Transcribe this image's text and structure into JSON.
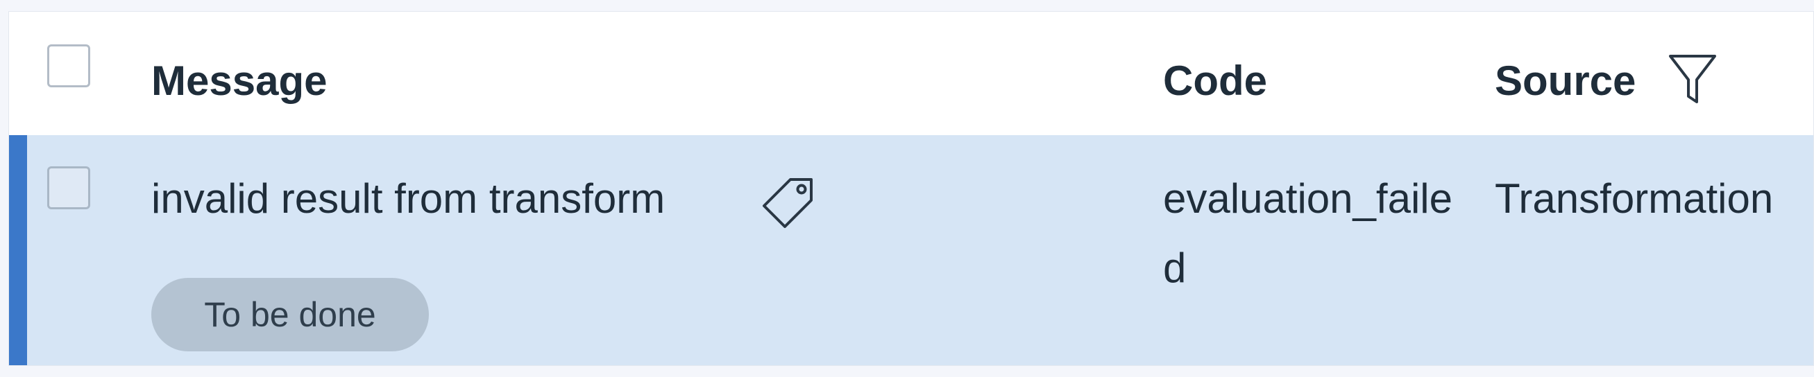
{
  "table": {
    "columns": {
      "message": "Message",
      "code": "Code",
      "source": "Source"
    },
    "rows": [
      {
        "message": "invalid result from transform",
        "status": "To be done",
        "code": "evaluation_failed",
        "source": "Transformation",
        "selected": true
      }
    ]
  },
  "colors": {
    "row_selected_bg": "#d6e5f5",
    "row_accent": "#3b78c9",
    "badge_bg": "#b4c3d2"
  },
  "icons": {
    "filter": "funnel-icon",
    "tag": "tag-icon"
  }
}
